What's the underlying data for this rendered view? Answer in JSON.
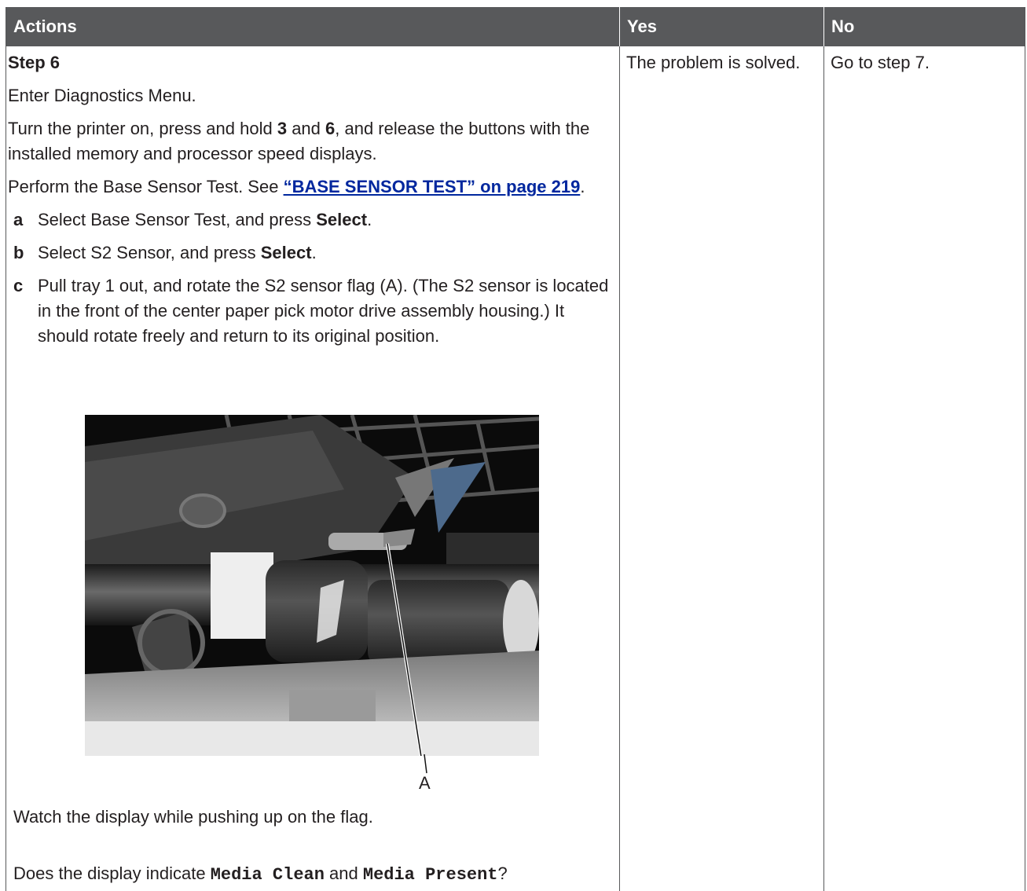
{
  "header": {
    "actions": "Actions",
    "yes": "Yes",
    "no": "No"
  },
  "step": {
    "title": "Step 6",
    "intro": "Enter Diagnostics Menu.",
    "power_on_1": "Turn the printer on, press and hold ",
    "key1": "3",
    "and": " and ",
    "key2": "6",
    "power_on_2": ", and release the buttons with the installed memory and processor speed displays.",
    "perform": "Perform the Base Sensor Test. See ",
    "link": "“BASE SENSOR TEST” on page 219",
    "period": ".",
    "a_letter": "a",
    "a_text": "Select Base Sensor Test, and press ",
    "a_bold": "Select",
    "b_letter": "b",
    "b_text": "Select S2 Sensor, and press ",
    "b_bold": "Select",
    "c_letter": "c",
    "c_text": "Pull tray 1 out, and rotate the S2 sensor flag (A). (The S2 sensor is located in the front of the center paper pick motor drive assembly housing.) It should rotate freely and return to its original position.",
    "callout": "A",
    "watch": "Watch the display while pushing up on the flag.",
    "q_1": "Does the display indicate ",
    "q_code1": "Media Clean",
    "q_and": " and ",
    "q_code2": "Media Present",
    "q_end": "?"
  },
  "yes_text": "The problem is solved.",
  "no_text": "Go to step 7."
}
